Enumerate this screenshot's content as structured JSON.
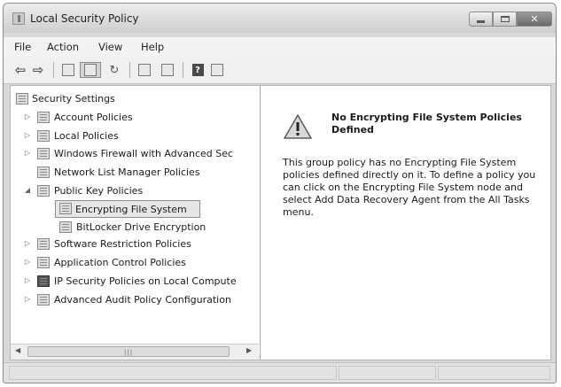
{
  "window": {
    "title": "Local Security Policy"
  },
  "menu": [
    "File",
    "Action",
    "View",
    "Help"
  ],
  "toolbar": {
    "icons": [
      "back-arrow-icon",
      "forward-arrow-icon",
      "up-folder-icon",
      "show-hide-tree-icon",
      "refresh-icon",
      "export-list-icon",
      "properties-icon",
      "help-icon",
      "console-view-icon"
    ]
  },
  "tree": {
    "root": "Security Settings",
    "items": [
      {
        "label": "Account Policies"
      },
      {
        "label": "Local Policies"
      },
      {
        "label": "Windows Firewall with Advanced Sec"
      },
      {
        "label": "Network List Manager Policies"
      },
      {
        "label": "Public Key Policies"
      },
      {
        "label": "Encrypting File System"
      },
      {
        "label": "BitLocker Drive Encryption"
      },
      {
        "label": "Software Restriction Policies"
      },
      {
        "label": "Application Control Policies"
      },
      {
        "label": "IP Security Policies on Local Compute"
      },
      {
        "label": "Advanced Audit Policy Configuration"
      }
    ],
    "selected": "Encrypting File System"
  },
  "details": {
    "icon": "warning-icon",
    "title": "No Encrypting File System Policies Defined",
    "body": "This group policy has no Encrypting File System policies defined directly on it. To define a policy you can click on the Encrypting File System node and select Add Data Recovery Agent from the All Tasks menu."
  },
  "colors": {
    "selection": "#e6e6e6",
    "titlebar": "#d9d9d9"
  }
}
